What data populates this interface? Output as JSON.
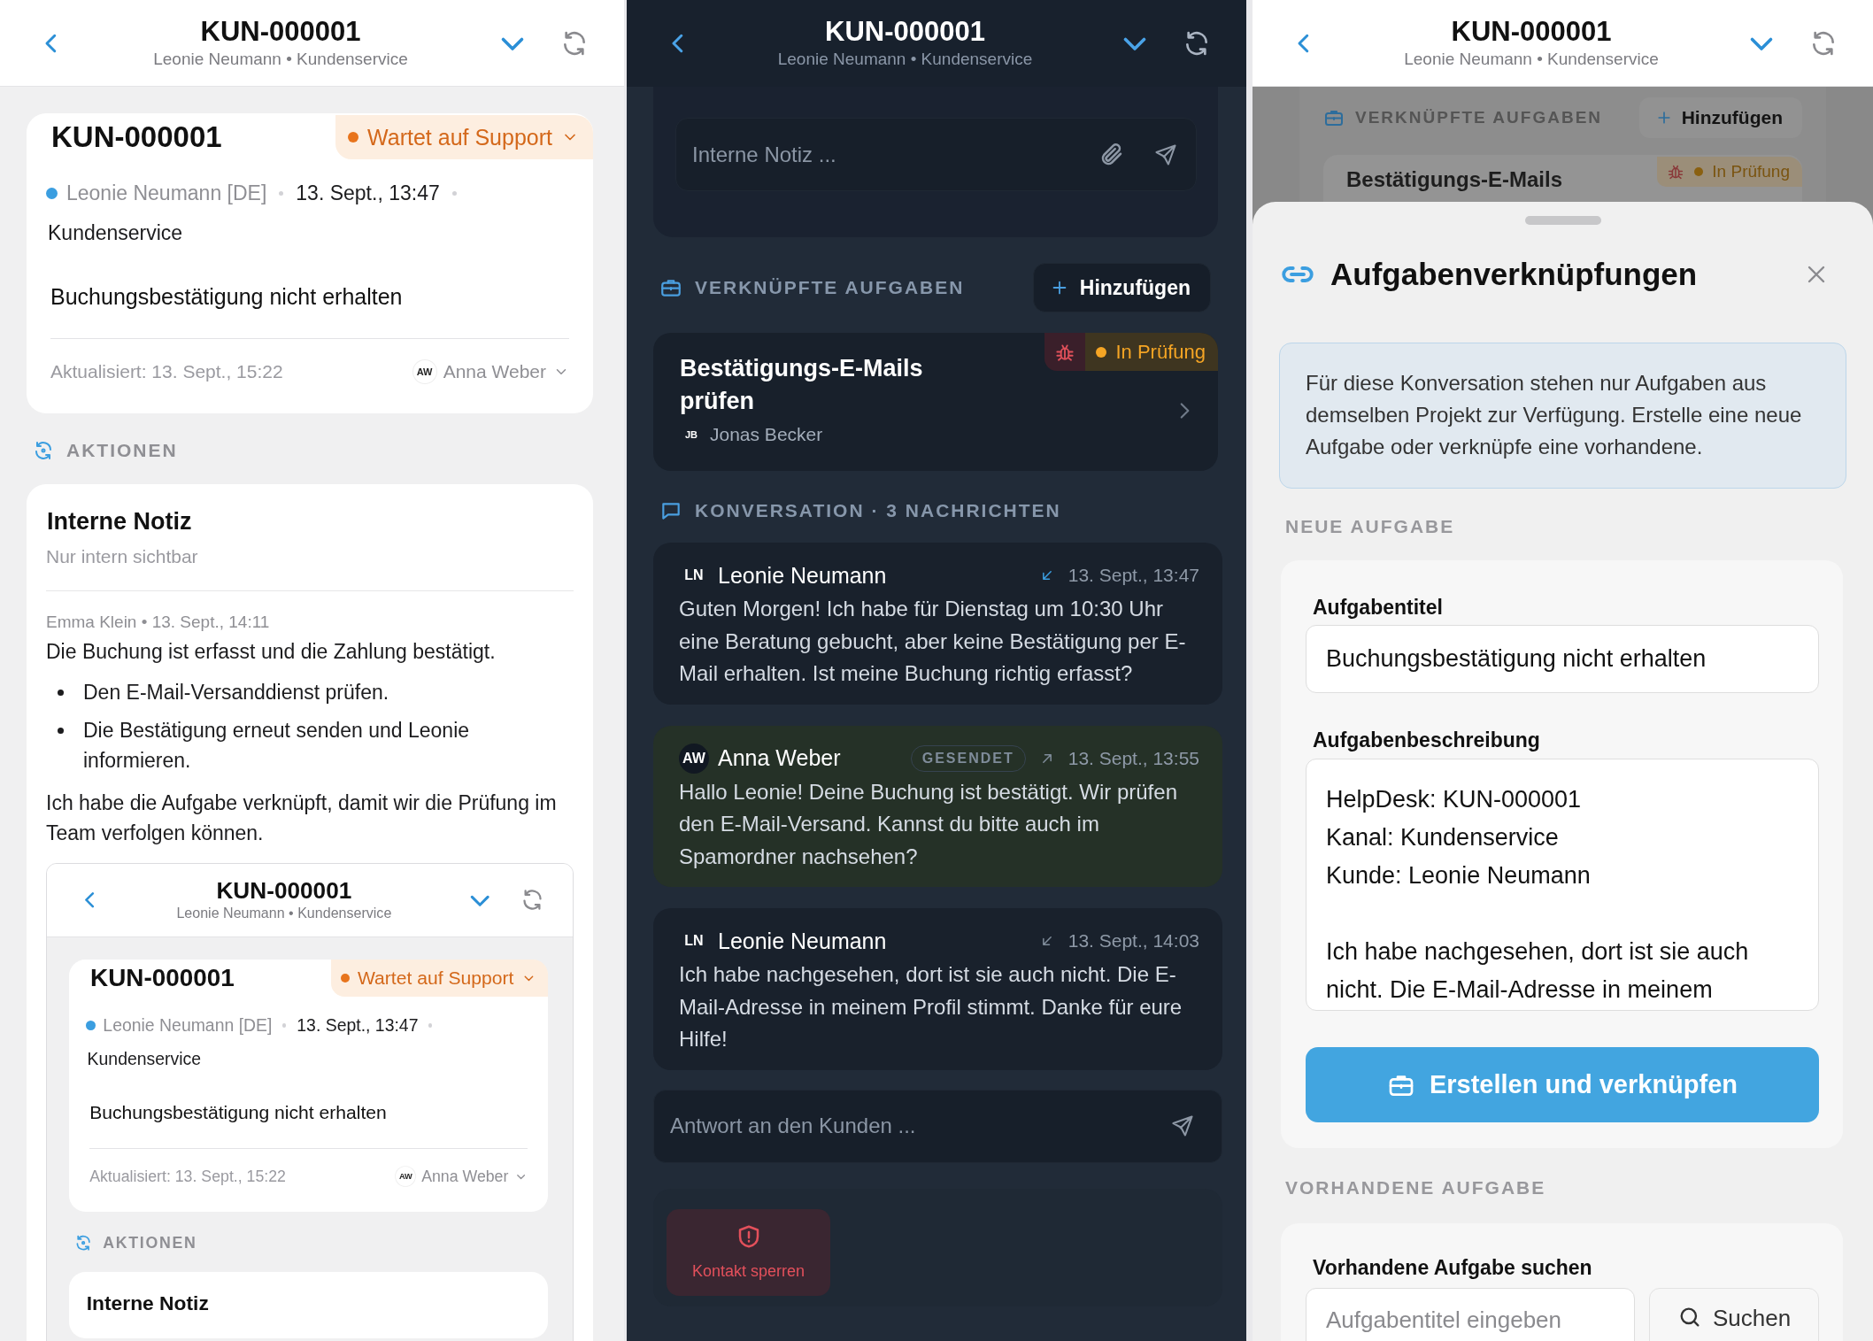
{
  "screens": [
    {
      "kind": "ticket",
      "header": {
        "title": "KUN-000001",
        "subtitle": "Leonie Neumann • Kundenservice"
      },
      "ticket": {
        "id": "KUN-000001",
        "status": "Wartet auf Support",
        "customer": "Leonie Neumann [DE]",
        "created": "13. Sept., 13:47",
        "channel": "Kundenservice",
        "subject": "Buchungsbestätigung nicht erhalten",
        "updated": "Aktualisiert: 13. Sept., 15:22",
        "assignee": {
          "initials": "AW",
          "name": "Anna Weber"
        }
      },
      "actions_heading": "AKTIONEN",
      "note": {
        "title": "Interne Notiz",
        "subtitle": "Nur intern sichtbar",
        "author": "Emma Klein • 13. Sept., 14:11",
        "blocks": [
          {
            "kind": "text",
            "text": "Die Buchung ist erfasst und die Zahlung bestätigt."
          },
          {
            "kind": "bullets",
            "items": [
              "Den E-Mail-Versanddienst prüfen.",
              "Die Bestätigung erneut senden und Leonie informieren."
            ]
          },
          {
            "kind": "text",
            "text": "Ich habe die Aufgabe verknüpft, damit wir die Prüfung im Team verfolgen können."
          }
        ],
        "embedded_screen": {
          "header": {
            "title": "KUN-000001",
            "subtitle": "Leonie Neumann • Kundenservice"
          },
          "ticket": {
            "id": "KUN-000001",
            "status": "Wartet auf Support",
            "customer": "Leonie Neumann [DE]",
            "created": "13. Sept., 13:47",
            "channel": "Kundenservice",
            "subject": "Buchungsbestätigung nicht erhalten",
            "updated": "Aktualisiert: 13. Sept., 15:22",
            "assignee": {
              "initials": "AW",
              "name": "Anna Weber"
            }
          },
          "actions_heading": "AKTIONEN",
          "note_title": "Interne Notiz"
        }
      }
    },
    {
      "kind": "conversation",
      "header": {
        "title": "KUN-000001",
        "subtitle": "Leonie Neumann • Kundenservice"
      },
      "note_input": {
        "placeholder": "Interne Notiz ..."
      },
      "tasks_heading": "VERKNÜPFTE AUFGABEN",
      "add_button": "Hinzufügen",
      "tasks": [
        {
          "title": "Bestätigungs-E-Mails prüfen",
          "assignee": {
            "initials": "JB",
            "name": "Jonas Becker"
          },
          "status": "In Prüfung"
        }
      ],
      "conversation_heading": "KONVERSATION · 3 NACHRICHTEN",
      "messages": [
        {
          "kind": "incoming",
          "unread": true,
          "initials": "LN",
          "author": "Leonie Neumann",
          "time": "13. Sept., 13:47",
          "text": "Guten Morgen! Ich habe für Dienstag um 10:30 Uhr eine Beratung gebucht, aber keine Bestätigung per E-Mail erhalten. Ist meine Buchung richtig erfasst?"
        },
        {
          "kind": "outgoing",
          "unread": false,
          "initials": "AW",
          "author": "Anna Weber",
          "badge": "GESENDET",
          "time": "13. Sept., 13:55",
          "text": "Hallo Leonie! Deine Buchung ist bestätigt. Wir prüfen den E-Mail-Versand. Kannst du bitte auch im Spamordner nachsehen?"
        },
        {
          "kind": "incoming",
          "unread": false,
          "initials": "LN",
          "author": "Leonie Neumann",
          "time": "13. Sept., 14:03",
          "text": "Ich habe nachgesehen, dort ist sie auch nicht. Die E-Mail-Adresse in meinem Profil stimmt. Danke für eure Hilfe!"
        }
      ],
      "reply_input": {
        "placeholder": "Antwort an den Kunden ..."
      },
      "block_button": "Kontakt sperren"
    },
    {
      "kind": "task_link_sheet",
      "header": {
        "title": "KUN-000001",
        "subtitle": "Leonie Neumann • Kundenservice"
      },
      "background": {
        "tasks_heading": "VERKNÜPFTE AUFGABEN",
        "add_button": "Hinzufügen",
        "task_title": "Bestätigungs-E-Mails",
        "task_status": "In Prüfung"
      },
      "sheet": {
        "title": "Aufgabenverknüpfungen",
        "info": "Für diese Konversation stehen nur Aufgaben aus demselben Projekt zur Verfügung. Erstelle eine neue Aufgabe oder verknüpfe eine vorhandene.",
        "new_heading": "NEUE AUFGABE",
        "title_label": "Aufgabentitel",
        "title_value": "Buchungsbestätigung nicht erhalten",
        "description_label": "Aufgabenbeschreibung",
        "description_value": "HelpDesk: KUN-000001\nKanal: Kundenservice\nKunde: Leonie Neumann\n\nIch habe nachgesehen, dort ist sie auch nicht. Die E-Mail-Adresse in meinem",
        "create_button": "Erstellen und verknüpfen",
        "existing_heading": "VORHANDENE AUFGABE",
        "search_label": "Vorhandene Aufgabe suchen",
        "search_placeholder": "Aufgabentitel eingeben",
        "search_button": "Suchen"
      }
    }
  ]
}
